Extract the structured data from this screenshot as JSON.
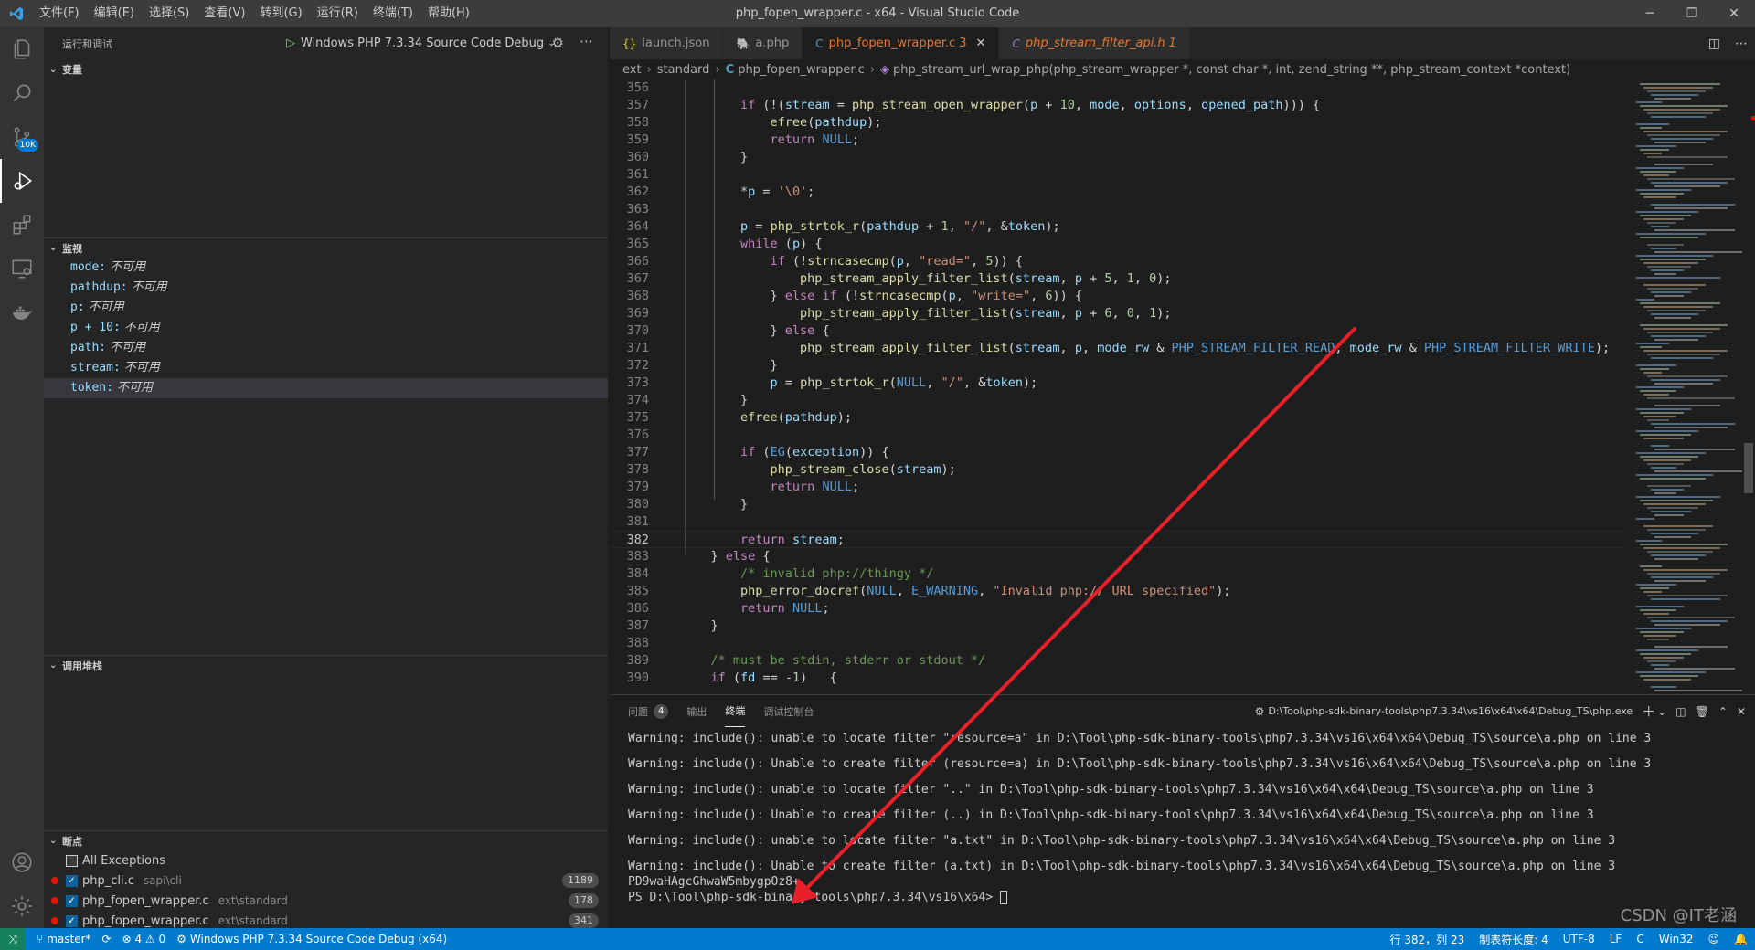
{
  "titlebar": {
    "menu": [
      "文件(F)",
      "编辑(E)",
      "选择(S)",
      "查看(V)",
      "转到(G)",
      "运行(R)",
      "终端(T)",
      "帮助(H)"
    ],
    "title": "php_fopen_wrapper.c - x64 - Visual Studio Code"
  },
  "activity": {
    "scm_badge": "10K"
  },
  "sidebar": {
    "header": "运行和调试",
    "config": "Windows PHP 7.3.34 Source Code Debug",
    "sections": {
      "variables": "变量",
      "watch": "监视",
      "callstack": "调用堆栈",
      "breakpoints": "断点"
    },
    "watch": [
      {
        "name": "mode:",
        "value": "不可用"
      },
      {
        "name": "pathdup:",
        "value": "不可用"
      },
      {
        "name": "p:",
        "value": "不可用"
      },
      {
        "name": "p + 10:",
        "value": "不可用"
      },
      {
        "name": "path:",
        "value": "不可用"
      },
      {
        "name": "stream:",
        "value": "不可用"
      },
      {
        "name": "token:",
        "value": "不可用"
      }
    ],
    "breakpoints": [
      {
        "label": "All Exceptions",
        "path": "",
        "count": "",
        "dot": false
      },
      {
        "label": "php_cli.c",
        "path": "sapi\\cli",
        "count": "1189",
        "dot": true
      },
      {
        "label": "php_fopen_wrapper.c",
        "path": "ext\\standard",
        "count": "178",
        "dot": true
      },
      {
        "label": "php_fopen_wrapper.c",
        "path": "ext\\standard",
        "count": "341",
        "dot": true
      }
    ]
  },
  "tabs": [
    {
      "icon": "{}",
      "label": "launch.json",
      "extra": ""
    },
    {
      "icon": "php",
      "label": "a.php",
      "extra": ""
    },
    {
      "icon": "C",
      "label": "php_fopen_wrapper.c",
      "extra": "3"
    },
    {
      "icon": "C",
      "label": "php_stream_filter_api.h",
      "extra": "1"
    }
  ],
  "breadcrumb": {
    "parts": [
      "ext",
      "standard",
      "php_fopen_wrapper.c"
    ],
    "symbol": "php_stream_url_wrap_php(php_stream_wrapper *, const char *, int, zend_string **, php_stream_context *context)"
  },
  "code": {
    "current_line": 382,
    "lines": [
      {
        "n": "356",
        "t": ""
      },
      {
        "n": "357",
        "t": "        if (!(stream = php_stream_open_wrapper(p + 10, mode, options, opened_path))) {"
      },
      {
        "n": "358",
        "t": "            efree(pathdup);"
      },
      {
        "n": "359",
        "t": "            return NULL;"
      },
      {
        "n": "360",
        "t": "        }"
      },
      {
        "n": "361",
        "t": ""
      },
      {
        "n": "362",
        "t": "        *p = '\\0';"
      },
      {
        "n": "363",
        "t": ""
      },
      {
        "n": "364",
        "t": "        p = php_strtok_r(pathdup + 1, \"/\", &token);"
      },
      {
        "n": "365",
        "t": "        while (p) {"
      },
      {
        "n": "366",
        "t": "            if (!strncasecmp(p, \"read=\", 5)) {"
      },
      {
        "n": "367",
        "t": "                php_stream_apply_filter_list(stream, p + 5, 1, 0);"
      },
      {
        "n": "368",
        "t": "            } else if (!strncasecmp(p, \"write=\", 6)) {"
      },
      {
        "n": "369",
        "t": "                php_stream_apply_filter_list(stream, p + 6, 0, 1);"
      },
      {
        "n": "370",
        "t": "            } else {"
      },
      {
        "n": "371",
        "t": "                php_stream_apply_filter_list(stream, p, mode_rw & PHP_STREAM_FILTER_READ, mode_rw & PHP_STREAM_FILTER_WRITE);"
      },
      {
        "n": "372",
        "t": "            }"
      },
      {
        "n": "373",
        "t": "            p = php_strtok_r(NULL, \"/\", &token);"
      },
      {
        "n": "374",
        "t": "        }"
      },
      {
        "n": "375",
        "t": "        efree(pathdup);"
      },
      {
        "n": "376",
        "t": ""
      },
      {
        "n": "377",
        "t": "        if (EG(exception)) {"
      },
      {
        "n": "378",
        "t": "            php_stream_close(stream);"
      },
      {
        "n": "379",
        "t": "            return NULL;"
      },
      {
        "n": "380",
        "t": "        }"
      },
      {
        "n": "381",
        "t": ""
      },
      {
        "n": "382",
        "t": "        return stream;"
      },
      {
        "n": "383",
        "t": "    } else {"
      },
      {
        "n": "384",
        "t": "        /* invalid php://thingy */"
      },
      {
        "n": "385",
        "t": "        php_error_docref(NULL, E_WARNING, \"Invalid php:// URL specified\");"
      },
      {
        "n": "386",
        "t": "        return NULL;"
      },
      {
        "n": "387",
        "t": "    }"
      },
      {
        "n": "388",
        "t": ""
      },
      {
        "n": "389",
        "t": "    /* must be stdin, stderr or stdout */"
      },
      {
        "n": "390",
        "t": "    if (fd == -1)   {"
      }
    ]
  },
  "panel": {
    "tabs": [
      {
        "label": "问题",
        "badge": "4"
      },
      {
        "label": "输出",
        "badge": ""
      },
      {
        "label": "终端",
        "badge": ""
      },
      {
        "label": "调试控制台",
        "badge": ""
      }
    ],
    "terminal_name": "D:\\Tool\\php-sdk-binary-tools\\php7.3.34\\vs16\\x64\\x64\\Debug_TS\\php.exe",
    "terminal_lines": [
      "Warning: include(): unable to locate filter \"resource=a\" in D:\\Tool\\php-sdk-binary-tools\\php7.3.34\\vs16\\x64\\x64\\Debug_TS\\source\\a.php on line 3",
      "",
      "Warning: include(): Unable to create filter (resource=a) in D:\\Tool\\php-sdk-binary-tools\\php7.3.34\\vs16\\x64\\x64\\Debug_TS\\source\\a.php on line 3",
      "",
      "Warning: include(): unable to locate filter \"..\" in D:\\Tool\\php-sdk-binary-tools\\php7.3.34\\vs16\\x64\\x64\\Debug_TS\\source\\a.php on line 3",
      "",
      "Warning: include(): Unable to create filter (..) in D:\\Tool\\php-sdk-binary-tools\\php7.3.34\\vs16\\x64\\x64\\Debug_TS\\source\\a.php on line 3",
      "",
      "Warning: include(): unable to locate filter \"a.txt\" in D:\\Tool\\php-sdk-binary-tools\\php7.3.34\\vs16\\x64\\x64\\Debug_TS\\source\\a.php on line 3",
      "",
      "Warning: include(): Unable to create filter (a.txt) in D:\\Tool\\php-sdk-binary-tools\\php7.3.34\\vs16\\x64\\x64\\Debug_TS\\source\\a.php on line 3",
      "PD9waHAgcGhwaW5mbygpOz8+"
    ],
    "prompt": "PS D:\\Tool\\php-sdk-binary-tools\\php7.3.34\\vs16\\x64> "
  },
  "statusbar": {
    "branch": "master*",
    "problems": "⊗ 4 ⚠ 0",
    "debug": "Windows PHP 7.3.34 Source Code Debug (x64)",
    "position": "行 382，列 23",
    "indent": "制表符长度: 4",
    "encoding": "UTF-8",
    "eol": "LF",
    "lang": "C",
    "platform": "Win32"
  },
  "watermark": "CSDN @IT老涵",
  "colors": {
    "accent": "#007acc",
    "annotation_arrow": "#e8202a"
  }
}
